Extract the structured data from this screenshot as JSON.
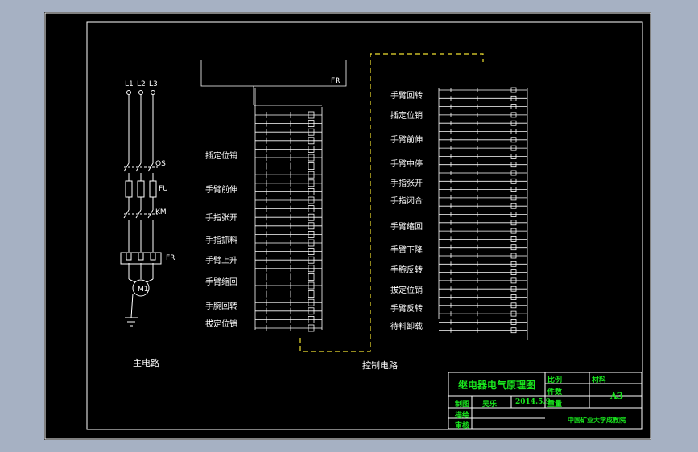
{
  "main_circuit": {
    "caption": "主电路",
    "phases": [
      "L1",
      "L2",
      "L3"
    ],
    "switch": "QS",
    "fuse": "FU",
    "contactor": "KM",
    "relay": "FR",
    "motor": "M1"
  },
  "control_circuit": {
    "caption": "控制电路",
    "relay_tag": "FR",
    "left_labels": [
      "插定位销",
      "手臂前伸",
      "手指张开",
      "手指抓料",
      "手臂上升",
      "手臂缩回",
      "手腕回转",
      "拔定位销"
    ],
    "right_labels": [
      "手臂回转",
      "插定位销",
      "手臂前伸",
      "手臂中停",
      "手指张开",
      "手指闭合",
      "手臂缩回",
      "手臂下降",
      "手腕反转",
      "拔定位销",
      "手臂反转",
      "待料卸载"
    ]
  },
  "title_block": {
    "title": "继电器电气原理图",
    "scale_label": "比例",
    "count_label": "件数",
    "material_label": "材料",
    "weight_label": "重量",
    "sheet_size": "A3",
    "drawn_label": "制图",
    "drawn_by": "吴乐",
    "date": "2014.5.9",
    "design_label": "描绘",
    "review_label": "审核",
    "school": "中国矿业大学成教院"
  },
  "colors": {
    "background": "#a6b1c3",
    "sheet": "#000000",
    "line": "#ffffff",
    "dashed": "#f0e030",
    "title_text": "#19e61e"
  }
}
